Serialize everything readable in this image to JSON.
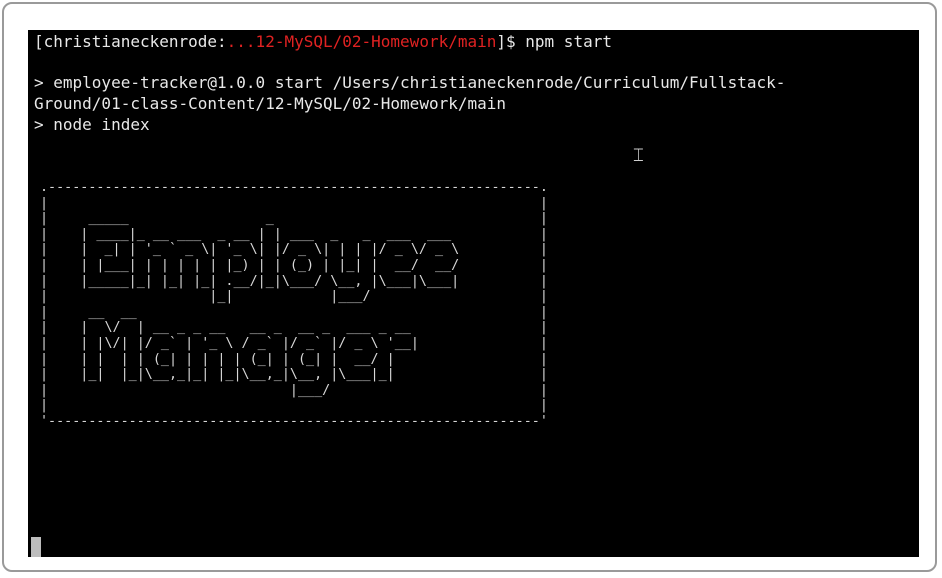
{
  "terminal": {
    "prompt": {
      "user": "[christianeckenrode:",
      "path": "...12-MySQL/02-Homework/main",
      "suffix": "]$ npm start"
    },
    "output": [
      "> employee-tracker@1.0.0 start /Users/christianeckenrode/Curriculum/Fullstack-",
      "Ground/01-class-Content/12-MySQL/02-Homework/main",
      "> node index"
    ],
    "banner": ".-------------------------------------------------------------.\n|                                                             |\n|     _____                 _                                 |\n|    | ____|_ __ ___  _ __ | | ___  _   _  ___  ___           |\n|    |  _| | '_ ` _ \\| '_ \\| |/ _ \\| | | |/ _ \\/ _ \\          |\n|    | |___| | | | | | |_) | | (_) | |_| |  __/  __/          |\n|    |_____|_| |_| |_| .__/|_|\\___/ \\__, |\\___|\\___|          |\n|                    |_|            |___/                     |\n|     __  __                                                  |\n|    |  \\/  | __ _ _ __   __ _  __ _  ___ _ __                |\n|    | |\\/| |/ _` | '_ \\ / _` |/ _` |/ _ \\ '__|               |\n|    | |  | | (_| | | | | (_| | (_| |  __/ |                  |\n|    |_|  |_|\\__,_|_| |_|\\__,_|\\__, |\\___|_|                  |\n|                              |___/                          |\n|                                                             |\n'-------------------------------------------------------------'",
    "cursor_icon": "text-cursor-icon",
    "colors": {
      "background": "#000000",
      "text": "#e8e8e8",
      "path": "#e02222",
      "cursor": "#bdbdbd"
    }
  }
}
